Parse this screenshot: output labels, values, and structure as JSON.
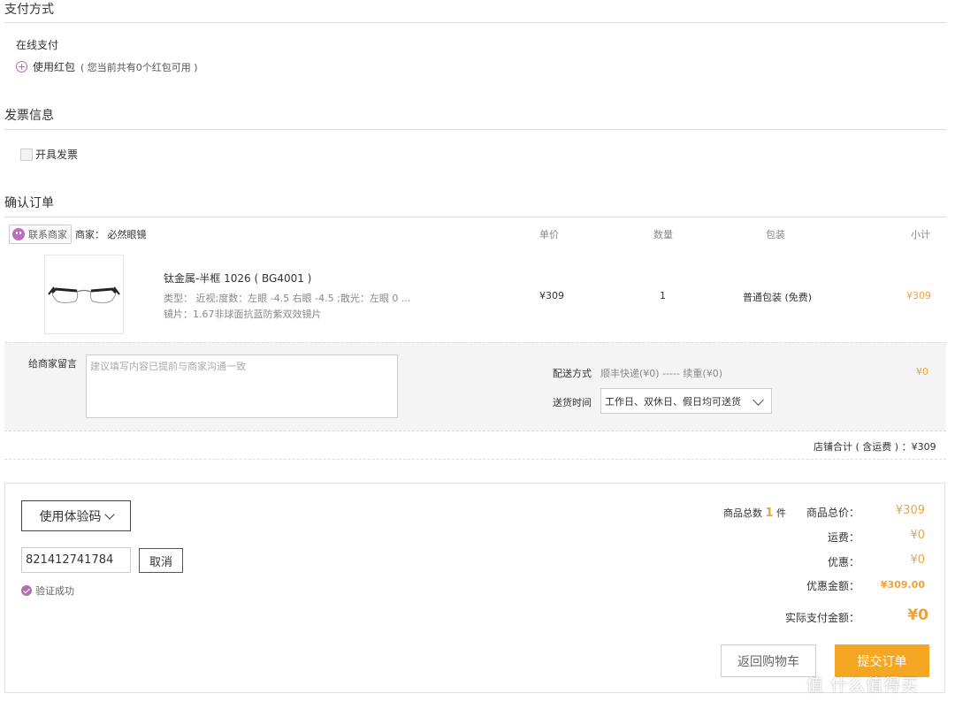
{
  "payment": {
    "title": "支付方式",
    "online": "在线支付",
    "use_redpacket": "使用红包",
    "redpacket_note": "( 您当前共有0个红包可用 )"
  },
  "invoice": {
    "title": "发票信息",
    "open_invoice": "开具发票"
  },
  "order": {
    "title": "确认订单",
    "contact_merchant": "联系商家",
    "merchant": "商家： 必然眼镜",
    "columns": {
      "unit_price": "单价",
      "quantity": "数量",
      "package": "包装",
      "subtotal": "小计"
    },
    "item": {
      "name": "钛金属-半框 1026 ( BG4001 )",
      "spec": "类型： 近视;度数：左眼 -4.5 右眼 -4.5 ;散光：左眼 0 ...",
      "lens": "镜片：1.67非球面抗蓝防紫双效镜片",
      "unit_price": "¥309",
      "quantity": "1",
      "package": "普通包装 (免费)",
      "subtotal": "¥309"
    },
    "message_label": "给商家留言",
    "message_placeholder": "建议填写内容已提前与商家沟通一致",
    "delivery_label": "配送方式",
    "delivery_value": "顺丰快递(¥0) ----- 续重(¥0)",
    "delivery_fee": "¥0",
    "time_label": "送货时间",
    "time_value": "工作日、双休日、假日均可送货",
    "store_total": "店铺合计 ( 含运费 ) ：¥309"
  },
  "summary": {
    "use_code_button": "使用体验码",
    "code_value": "821412741784",
    "cancel_button": "取消",
    "verified": "验证成功",
    "count_prefix": "商品总数",
    "count": "1",
    "count_suffix": "件",
    "goods_total_label": "商品总价：",
    "goods_total": "¥309",
    "shipping_label": "运费：",
    "shipping": "¥0",
    "discount_label": "优惠：",
    "discount": "¥0",
    "discount_amount_label": "优惠金额：",
    "discount_amount": "¥309.00",
    "pay_label": "实际支付金额：",
    "pay_amount": "¥0",
    "back_button": "返回购物车",
    "submit_button": "提交订单"
  },
  "watermark": "值 什么值得买",
  "colors": {
    "accent": "#f5a623",
    "purple": "#b071b0"
  }
}
